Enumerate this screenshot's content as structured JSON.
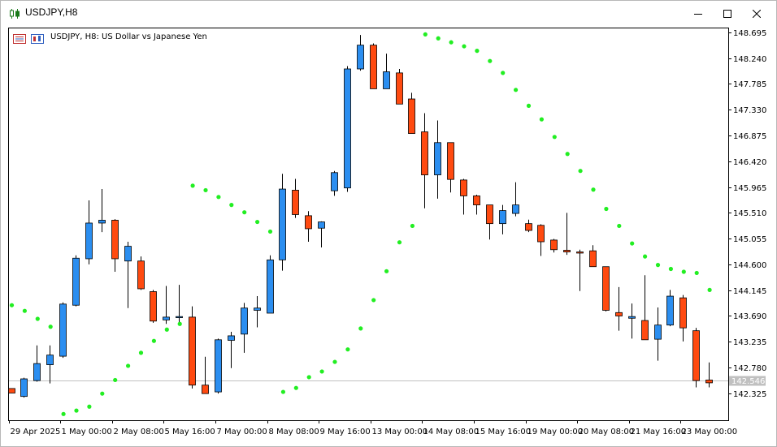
{
  "window": {
    "title": "USDJPY,H8",
    "icon": "candlestick-icon",
    "buttons": {
      "minimize": "minimize-icon",
      "maximize": "maximize-icon",
      "close": "close-icon"
    }
  },
  "colors": {
    "bull": "#2b8ef0",
    "bear": "#ff4a10",
    "wick": "#000000",
    "sar": "#22ee22",
    "grid": "#c8c8c8",
    "price_line": "#c0c0c0",
    "price_label_bg": "#c0c0c0"
  },
  "chart_data": {
    "type": "candlestick",
    "title": "USDJPY, H8:  US Dollar vs Japanese Yen",
    "legend": {
      "placement": "top-left",
      "icons": [
        "indicator-list-icon",
        "chart-properties-icon"
      ]
    },
    "grid": false,
    "y_axis": {
      "side": "right",
      "range": [
        141.85,
        148.78
      ],
      "ticks": [
        148.695,
        148.24,
        147.785,
        147.33,
        146.875,
        146.42,
        145.965,
        145.51,
        145.055,
        144.6,
        144.145,
        143.69,
        143.235,
        142.78,
        142.325
      ]
    },
    "x_axis": {
      "tick_labels": [
        {
          "index": 0,
          "label": "29 Apr 2025"
        },
        {
          "index": 4,
          "label": "1 May 00:00"
        },
        {
          "index": 8,
          "label": "2 May 08:00"
        },
        {
          "index": 12,
          "label": "5 May 16:00"
        },
        {
          "index": 16,
          "label": "7 May 00:00"
        },
        {
          "index": 20,
          "label": "8 May 08:00"
        },
        {
          "index": 24,
          "label": "9 May 16:00"
        },
        {
          "index": 28,
          "label": "13 May 00:00"
        },
        {
          "index": 32,
          "label": "14 May 08:00"
        },
        {
          "index": 36,
          "label": "15 May 16:00"
        },
        {
          "index": 40,
          "label": "19 May 00:00"
        },
        {
          "index": 44,
          "label": "20 May 08:00"
        },
        {
          "index": 48,
          "label": "21 May 16:00"
        },
        {
          "index": 52,
          "label": "23 May 00:00"
        }
      ]
    },
    "current_price": 142.546,
    "candles": [
      {
        "o": 142.41,
        "h": 142.41,
        "l": 142.33,
        "c": 142.33
      },
      {
        "o": 142.27,
        "h": 142.6,
        "l": 142.25,
        "c": 142.58
      },
      {
        "o": 142.55,
        "h": 143.17,
        "l": 142.53,
        "c": 142.85
      },
      {
        "o": 142.83,
        "h": 143.17,
        "l": 142.5,
        "c": 143.0
      },
      {
        "o": 142.98,
        "h": 143.93,
        "l": 142.95,
        "c": 143.9
      },
      {
        "o": 143.88,
        "h": 144.76,
        "l": 143.86,
        "c": 144.71
      },
      {
        "o": 144.7,
        "h": 145.73,
        "l": 144.6,
        "c": 145.33
      },
      {
        "o": 145.33,
        "h": 145.93,
        "l": 145.17,
        "c": 145.38
      },
      {
        "o": 145.38,
        "h": 145.4,
        "l": 144.47,
        "c": 144.7
      },
      {
        "o": 144.66,
        "h": 145.0,
        "l": 143.83,
        "c": 144.92
      },
      {
        "o": 144.66,
        "h": 144.74,
        "l": 144.15,
        "c": 144.17
      },
      {
        "o": 144.12,
        "h": 144.15,
        "l": 143.57,
        "c": 143.6
      },
      {
        "o": 143.62,
        "h": 144.22,
        "l": 143.55,
        "c": 143.67
      },
      {
        "o": 143.66,
        "h": 144.24,
        "l": 143.55,
        "c": 143.68
      },
      {
        "o": 143.67,
        "h": 143.86,
        "l": 142.41,
        "c": 142.47
      },
      {
        "o": 142.47,
        "h": 142.97,
        "l": 142.32,
        "c": 142.32
      },
      {
        "o": 142.35,
        "h": 143.29,
        "l": 142.32,
        "c": 143.27
      },
      {
        "o": 143.26,
        "h": 143.41,
        "l": 142.77,
        "c": 143.34
      },
      {
        "o": 143.37,
        "h": 143.92,
        "l": 143.04,
        "c": 143.83
      },
      {
        "o": 143.79,
        "h": 144.04,
        "l": 143.49,
        "c": 143.83
      },
      {
        "o": 143.74,
        "h": 144.76,
        "l": 143.74,
        "c": 144.68
      },
      {
        "o": 144.68,
        "h": 146.2,
        "l": 144.49,
        "c": 145.93
      },
      {
        "o": 145.91,
        "h": 146.11,
        "l": 145.42,
        "c": 145.48
      },
      {
        "o": 145.46,
        "h": 145.54,
        "l": 145.0,
        "c": 145.23
      },
      {
        "o": 145.24,
        "h": 145.36,
        "l": 144.9,
        "c": 145.35
      },
      {
        "o": 145.9,
        "h": 146.25,
        "l": 145.81,
        "c": 146.22
      },
      {
        "o": 145.95,
        "h": 148.1,
        "l": 145.88,
        "c": 148.05
      },
      {
        "o": 148.05,
        "h": 148.65,
        "l": 148.02,
        "c": 148.47
      },
      {
        "o": 148.47,
        "h": 148.5,
        "l": 147.7,
        "c": 147.7
      },
      {
        "o": 147.7,
        "h": 148.32,
        "l": 147.7,
        "c": 148.0
      },
      {
        "o": 147.98,
        "h": 148.05,
        "l": 147.43,
        "c": 147.43
      },
      {
        "o": 147.52,
        "h": 147.63,
        "l": 146.91,
        "c": 146.91
      },
      {
        "o": 146.94,
        "h": 147.27,
        "l": 145.59,
        "c": 146.18
      },
      {
        "o": 146.18,
        "h": 147.14,
        "l": 145.76,
        "c": 146.75
      },
      {
        "o": 146.75,
        "h": 146.75,
        "l": 145.87,
        "c": 146.1
      },
      {
        "o": 146.09,
        "h": 146.11,
        "l": 145.48,
        "c": 145.81
      },
      {
        "o": 145.81,
        "h": 145.83,
        "l": 145.48,
        "c": 145.65
      },
      {
        "o": 145.65,
        "h": 145.65,
        "l": 145.04,
        "c": 145.32
      },
      {
        "o": 145.32,
        "h": 145.65,
        "l": 145.13,
        "c": 145.55
      },
      {
        "o": 145.5,
        "h": 146.05,
        "l": 145.45,
        "c": 145.65
      },
      {
        "o": 145.32,
        "h": 145.39,
        "l": 145.17,
        "c": 145.2
      },
      {
        "o": 145.29,
        "h": 145.31,
        "l": 144.75,
        "c": 145.0
      },
      {
        "o": 145.03,
        "h": 145.05,
        "l": 144.81,
        "c": 144.86
      },
      {
        "o": 144.85,
        "h": 145.51,
        "l": 144.77,
        "c": 144.82
      },
      {
        "o": 144.82,
        "h": 144.86,
        "l": 144.13,
        "c": 144.8
      },
      {
        "o": 144.84,
        "h": 144.94,
        "l": 144.56,
        "c": 144.56
      },
      {
        "o": 144.56,
        "h": 144.56,
        "l": 143.77,
        "c": 143.79
      },
      {
        "o": 143.75,
        "h": 144.2,
        "l": 143.43,
        "c": 143.69
      },
      {
        "o": 143.65,
        "h": 143.91,
        "l": 143.29,
        "c": 143.68
      },
      {
        "o": 143.61,
        "h": 144.41,
        "l": 143.27,
        "c": 143.27
      },
      {
        "o": 143.28,
        "h": 143.84,
        "l": 142.9,
        "c": 143.53
      },
      {
        "o": 143.53,
        "h": 144.15,
        "l": 143.51,
        "c": 144.04
      },
      {
        "o": 144.01,
        "h": 144.06,
        "l": 143.24,
        "c": 143.48
      },
      {
        "o": 143.43,
        "h": 143.48,
        "l": 142.43,
        "c": 142.55
      },
      {
        "o": 142.56,
        "h": 142.87,
        "l": 142.43,
        "c": 142.51
      }
    ],
    "parabolic_sar": [
      {
        "index": 0,
        "value": 143.88
      },
      {
        "index": 1,
        "value": 143.78
      },
      {
        "index": 2,
        "value": 143.64
      },
      {
        "index": 3,
        "value": 143.5
      },
      {
        "index": 4,
        "value": 141.96
      },
      {
        "index": 5,
        "value": 142.02
      },
      {
        "index": 6,
        "value": 142.09
      },
      {
        "index": 7,
        "value": 142.32
      },
      {
        "index": 8,
        "value": 142.56
      },
      {
        "index": 9,
        "value": 142.81
      },
      {
        "index": 10,
        "value": 143.04
      },
      {
        "index": 11,
        "value": 143.25
      },
      {
        "index": 12,
        "value": 143.45
      },
      {
        "index": 13,
        "value": 143.55
      },
      {
        "index": 14,
        "value": 145.99
      },
      {
        "index": 15,
        "value": 145.91
      },
      {
        "index": 16,
        "value": 145.79
      },
      {
        "index": 17,
        "value": 145.65
      },
      {
        "index": 18,
        "value": 145.52
      },
      {
        "index": 19,
        "value": 145.35
      },
      {
        "index": 20,
        "value": 145.18
      },
      {
        "index": 21,
        "value": 142.35
      },
      {
        "index": 22,
        "value": 142.42
      },
      {
        "index": 23,
        "value": 142.61
      },
      {
        "index": 24,
        "value": 142.71
      },
      {
        "index": 25,
        "value": 142.88
      },
      {
        "index": 26,
        "value": 143.1
      },
      {
        "index": 27,
        "value": 143.47
      },
      {
        "index": 28,
        "value": 143.97
      },
      {
        "index": 29,
        "value": 144.48
      },
      {
        "index": 30,
        "value": 144.99
      },
      {
        "index": 31,
        "value": 145.28
      },
      {
        "index": 32,
        "value": 148.66
      },
      {
        "index": 33,
        "value": 148.59
      },
      {
        "index": 34,
        "value": 148.52
      },
      {
        "index": 35,
        "value": 148.45
      },
      {
        "index": 36,
        "value": 148.37
      },
      {
        "index": 37,
        "value": 148.19
      },
      {
        "index": 38,
        "value": 147.98
      },
      {
        "index": 39,
        "value": 147.68
      },
      {
        "index": 40,
        "value": 147.4
      },
      {
        "index": 41,
        "value": 147.16
      },
      {
        "index": 42,
        "value": 146.85
      },
      {
        "index": 43,
        "value": 146.55
      },
      {
        "index": 44,
        "value": 146.25
      },
      {
        "index": 45,
        "value": 145.92
      },
      {
        "index": 46,
        "value": 145.58
      },
      {
        "index": 47,
        "value": 145.28
      },
      {
        "index": 48,
        "value": 144.97
      },
      {
        "index": 49,
        "value": 144.74
      },
      {
        "index": 50,
        "value": 144.59
      },
      {
        "index": 51,
        "value": 144.52
      },
      {
        "index": 52,
        "value": 144.47
      },
      {
        "index": 53,
        "value": 144.45
      },
      {
        "index": 54,
        "value": 144.15
      }
    ]
  }
}
